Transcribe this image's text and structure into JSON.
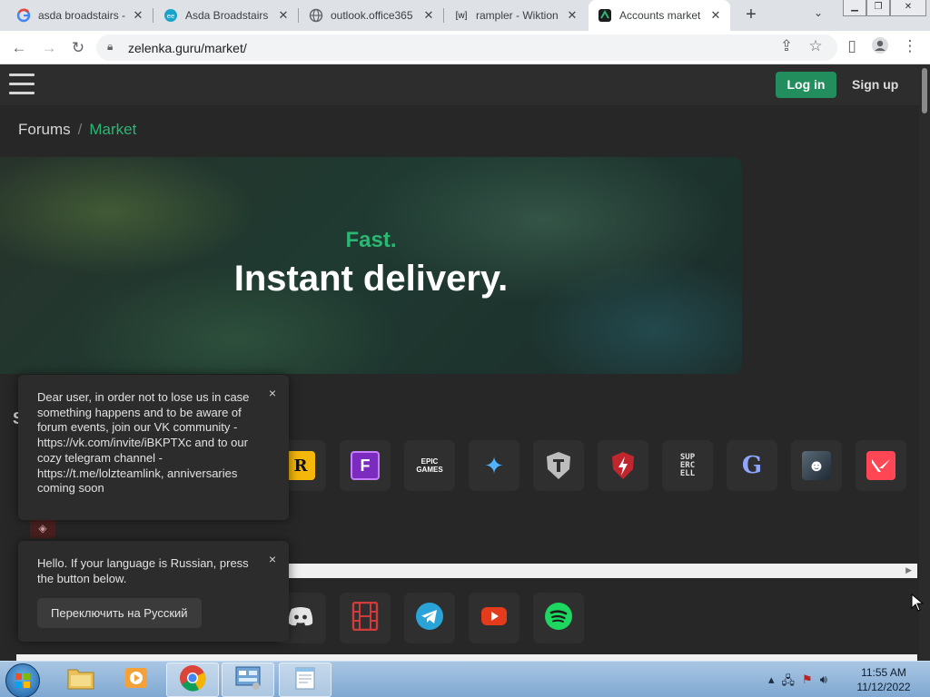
{
  "browser": {
    "tabs": [
      {
        "title": "asda broadstairs -",
        "favicon": "google-icon",
        "active": false
      },
      {
        "title": "Asda Broadstairs",
        "favicon": "asda-icon",
        "active": false
      },
      {
        "title": "outlook.office365",
        "favicon": "globe-icon",
        "active": false
      },
      {
        "title": "rampler - Wiktion",
        "favicon": "wiktionary-icon",
        "active": false
      },
      {
        "title": "Accounts market",
        "favicon": "lolz-icon",
        "active": true
      }
    ],
    "new_tab": "+",
    "url": "zelenka.guru/market/"
  },
  "site": {
    "login_label": "Log in",
    "signup_label": "Sign up",
    "accent_color": "#228e5d"
  },
  "breadcrumb": {
    "forums": "Forums",
    "separator": "/",
    "market": "Market"
  },
  "hero": {
    "tagline": "Fast.",
    "headline": "Instant delivery."
  },
  "section": {
    "heading_partial": "S"
  },
  "game_tiles": [
    {
      "name": "rockstar-icon",
      "glyph": "R"
    },
    {
      "name": "fortnite-icon",
      "glyph": "F"
    },
    {
      "name": "epic-games-icon",
      "glyph": "EPIC GAMES"
    },
    {
      "name": "battlenet-icon",
      "glyph": "✦"
    },
    {
      "name": "world-of-tanks-icon",
      "glyph": "T"
    },
    {
      "name": "wot-blitz-icon",
      "glyph": "⚡"
    },
    {
      "name": "supercell-icon",
      "glyph": "SUP ERC ELL"
    },
    {
      "name": "genshin-icon",
      "glyph": "G"
    },
    {
      "name": "escape-from-tarkov-icon",
      "glyph": "☻"
    },
    {
      "name": "valorant-icon",
      "glyph": "V"
    }
  ],
  "social_tiles": [
    {
      "name": "discord-icon"
    },
    {
      "name": "film-icon"
    },
    {
      "name": "telegram-icon"
    },
    {
      "name": "youtube-icon"
    },
    {
      "name": "spotify-icon"
    }
  ],
  "popups": {
    "vk_notice": "Dear user, in order not to lose us in case something happens and to be aware of forum events, join our VK community - https://vk.com/invite/iBKPTXc and to our cozy telegram channel - https://t.me/lolzteamlink, anniversaries coming soon",
    "language_notice": "Hello. If your language is Russian, press the button below.",
    "language_button": "Переключить на Русский",
    "close_glyph": "×"
  },
  "taskbar": {
    "time": "11:55 AM",
    "date": "11/12/2022"
  }
}
